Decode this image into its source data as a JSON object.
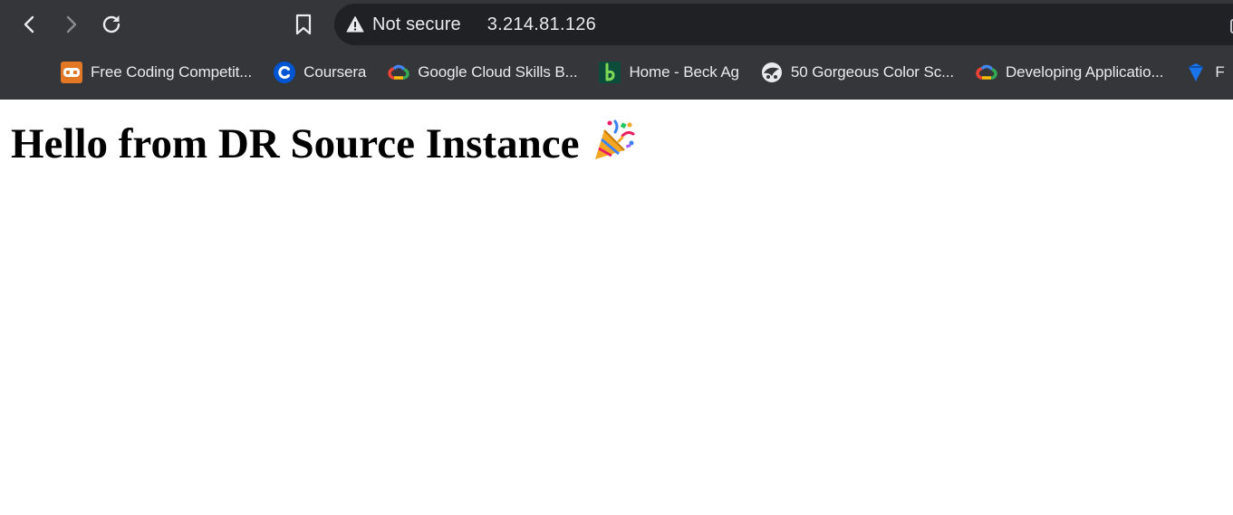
{
  "address_bar": {
    "security_label": "Not secure",
    "url": "3.214.81.126"
  },
  "bookmarks": [
    {
      "label": "Free Coding Competit...",
      "icon": "codechef-favicon"
    },
    {
      "label": "Coursera",
      "icon": "coursera-favicon"
    },
    {
      "label": "Google Cloud Skills B...",
      "icon": "google-cloud-favicon"
    },
    {
      "label": "Home - Beck Ag",
      "icon": "beck-ag-favicon"
    },
    {
      "label": "50 Gorgeous Color Sc...",
      "icon": "color-schemes-favicon"
    },
    {
      "label": "Developing Applicatio...",
      "icon": "google-cloud-favicon"
    },
    {
      "label": "F",
      "icon": "blue-diamond-favicon"
    }
  ],
  "page": {
    "heading": "Hello from DR Source Instance",
    "heading_icon": "party-popper-icon"
  }
}
